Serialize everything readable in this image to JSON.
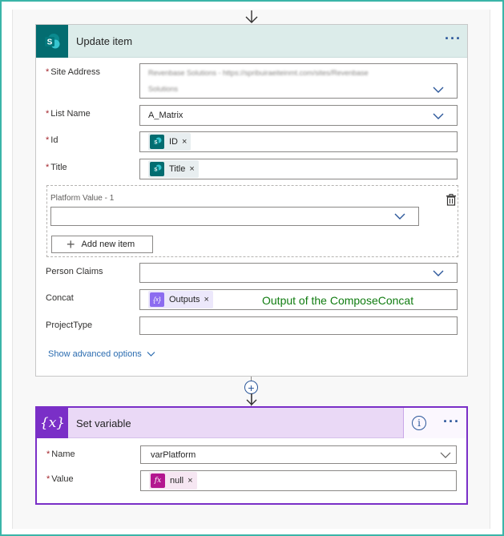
{
  "update_item": {
    "title": "Update item",
    "more_label": "···",
    "fields": {
      "site_address": {
        "label": "Site Address",
        "value_line1": "Revenbase Solutions - https://spribuiraeiteinmt.com/sites/Revenbase",
        "value_line2": "Solutions"
      },
      "list_name": {
        "label": "List Name",
        "value": "A_Matrix"
      },
      "id": {
        "label": "Id",
        "token": "ID"
      },
      "title": {
        "label": "Title",
        "token": "Title"
      },
      "platform_value": {
        "label": "Platform Value - 1",
        "add_label": "Add new item"
      },
      "person_claims": {
        "label": "Person Claims"
      },
      "concat": {
        "label": "Concat",
        "token": "Outputs"
      },
      "project_type": {
        "label": "ProjectType"
      }
    },
    "required_mark": "*",
    "token_close": "×",
    "advanced_label": "Show advanced options"
  },
  "annotation": "Output of the ComposeConcat",
  "set_variable": {
    "title": "Set variable",
    "logo_text": "{x}",
    "info_label": "i",
    "more_label": "···",
    "fields": {
      "name": {
        "label": "Name",
        "value": "varPlatform"
      },
      "value": {
        "label": "Value",
        "token": "null"
      }
    }
  },
  "colors": {
    "sharepoint": "#036c70",
    "variable": "#7a2fc7",
    "expression": "#b3168f",
    "compose": "#8c6cf0",
    "annotation": "#107c10",
    "link": "#2b6cb0"
  },
  "icons": [
    "arrow-down-icon",
    "sharepoint-icon",
    "chevron-down-icon",
    "trash-icon",
    "plus-icon",
    "variable-icon",
    "info-icon",
    "fx-icon",
    "compose-icon"
  ]
}
